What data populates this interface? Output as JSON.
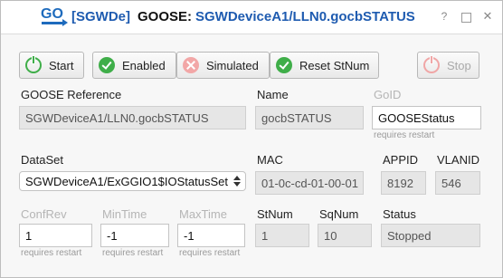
{
  "window": {
    "tag": "[SGWDe]",
    "title_prefix": "GOOSE:",
    "title_ref": "SGWDeviceA1/LLN0.gocbSTATUS",
    "help": "?",
    "close": "✕",
    "logo_text": "GO"
  },
  "toolbar": {
    "start_label": "Start",
    "enabled_label": "Enabled",
    "simulated_label": "Simulated",
    "reset_label": "Reset StNum",
    "stop_label": "Stop"
  },
  "form": {
    "goose_reference": {
      "label": "GOOSE Reference",
      "value": "SGWDeviceA1/LLN0.gocbSTATUS"
    },
    "name": {
      "label": "Name",
      "value": "gocbSTATUS"
    },
    "goid": {
      "label": "GoID",
      "value": "GOOSEStatus",
      "hint": "requires restart"
    },
    "dataset": {
      "label": "DataSet",
      "value": "SGWDeviceA1/ExGGIO1$IOStatusSet"
    },
    "mac": {
      "label": "MAC",
      "value": "01-0c-cd-01-00-01"
    },
    "appid": {
      "label": "APPID",
      "value": "8192"
    },
    "vlanid": {
      "label": "VLANID",
      "value": "546"
    },
    "confrev": {
      "label": "ConfRev",
      "value": "1",
      "hint": "requires restart"
    },
    "mintime": {
      "label": "MinTime",
      "value": "-1",
      "hint": "requires restart"
    },
    "maxtime": {
      "label": "MaxTime",
      "value": "-1",
      "hint": "requires restart"
    },
    "stnum": {
      "label": "StNum",
      "value": "1"
    },
    "sqnum": {
      "label": "SqNum",
      "value": "10"
    },
    "status": {
      "label": "Status",
      "value": "Stopped"
    }
  },
  "colors": {
    "accent": "#1e5bb0",
    "ok": "#3fae49",
    "danger_light": "#f2a7a7"
  },
  "icons": [
    "goose-logo-icon",
    "power-icon",
    "check-icon",
    "x-icon",
    "stop-icon",
    "help-icon",
    "maximize-icon",
    "close-icon",
    "dropdown-arrow-icon"
  ]
}
